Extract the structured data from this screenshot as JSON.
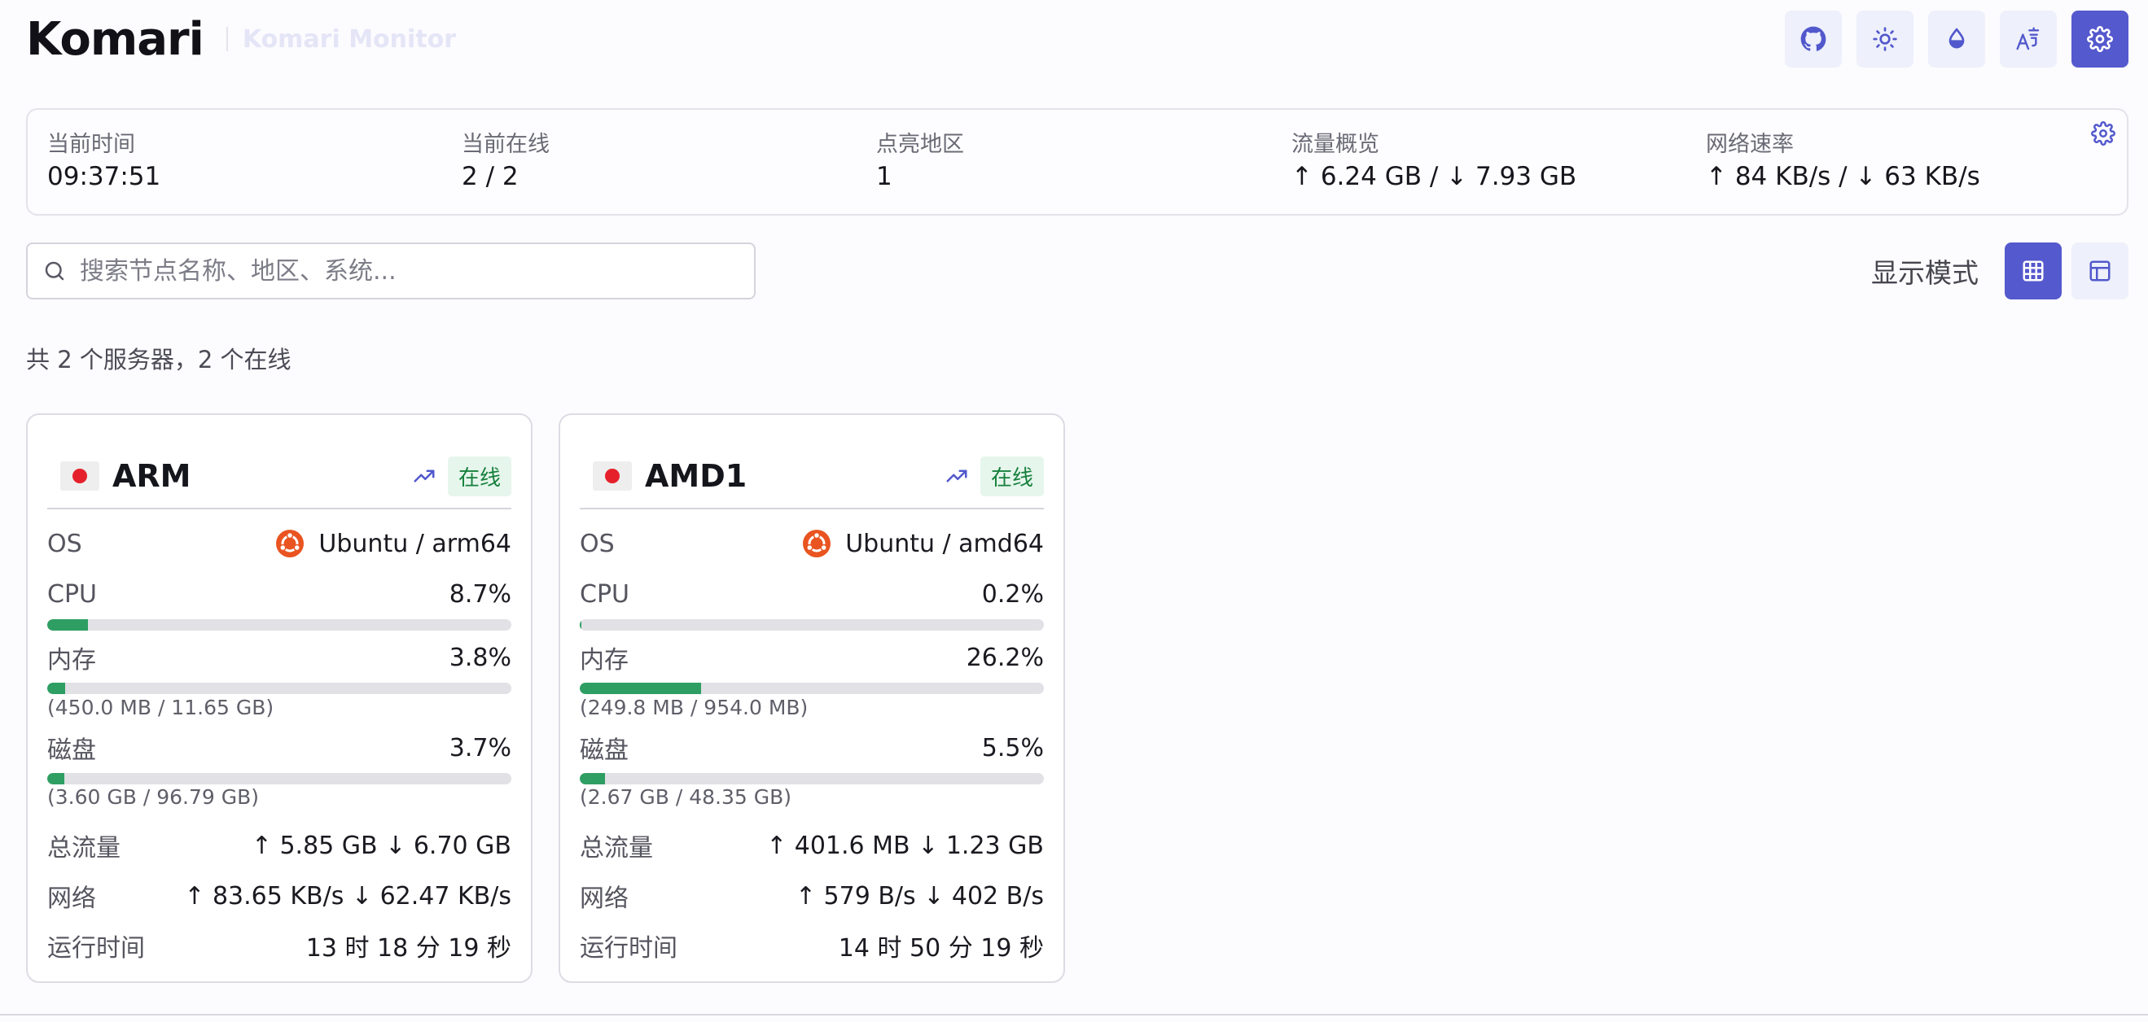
{
  "header": {
    "brand": "Komari",
    "subtitle": "Komari Monitor",
    "buttons": [
      "github-icon",
      "sun-icon",
      "droplet-icon",
      "translate-icon",
      "settings-icon"
    ]
  },
  "stats": [
    {
      "label": "当前时间",
      "value": "09:37:51"
    },
    {
      "label": "当前在线",
      "value": "2 / 2"
    },
    {
      "label": "点亮地区",
      "value": "1"
    },
    {
      "label": "流量概览",
      "value": "↑ 6.24 GB / ↓ 7.93 GB"
    },
    {
      "label": "网络速率",
      "value": "↑ 84 KB/s / ↓ 63 KB/s"
    }
  ],
  "search": {
    "placeholder": "搜索节点名称、地区、系统..."
  },
  "display_mode": {
    "label": "显示模式",
    "options": [
      "grid-icon",
      "table-icon"
    ],
    "active": 0
  },
  "summary": "共 2 个服务器，2 个在线",
  "colors": {
    "accent": "#5459cd",
    "online_badge_bg": "#e6f6ec",
    "online_badge_text": "#17803d",
    "bar_fill": "#2e9e62",
    "ubuntu": "#e95420"
  },
  "labels": {
    "os": "OS",
    "cpu": "CPU",
    "memory": "内存",
    "disk": "磁盘",
    "traffic": "总流量",
    "network": "网络",
    "uptime": "运行时间"
  },
  "servers": [
    {
      "name": "ARM",
      "status": "在线",
      "os": "Ubuntu / arm64",
      "cpu": "8.7%",
      "cpu_fraction": 0.087,
      "memory": "3.8%",
      "memory_fraction": 0.038,
      "memory_detail": "(450.0 MB / 11.65 GB)",
      "disk": "3.7%",
      "disk_fraction": 0.037,
      "disk_detail": "(3.60 GB / 96.79 GB)",
      "traffic": "↑ 5.85 GB ↓ 6.70 GB",
      "network": "↑ 83.65 KB/s ↓ 62.47 KB/s",
      "uptime": "13 时 18 分 19 秒"
    },
    {
      "name": "AMD1",
      "status": "在线",
      "os": "Ubuntu / amd64",
      "cpu": "0.2%",
      "cpu_fraction": 0.002,
      "memory": "26.2%",
      "memory_fraction": 0.262,
      "memory_detail": "(249.8 MB / 954.0 MB)",
      "disk": "5.5%",
      "disk_fraction": 0.055,
      "disk_detail": "(2.67 GB / 48.35 GB)",
      "traffic": "↑ 401.6 MB ↓ 1.23 GB",
      "network": "↑ 579 B/s ↓ 402 B/s",
      "uptime": "14 时 50 分 19 秒"
    }
  ]
}
